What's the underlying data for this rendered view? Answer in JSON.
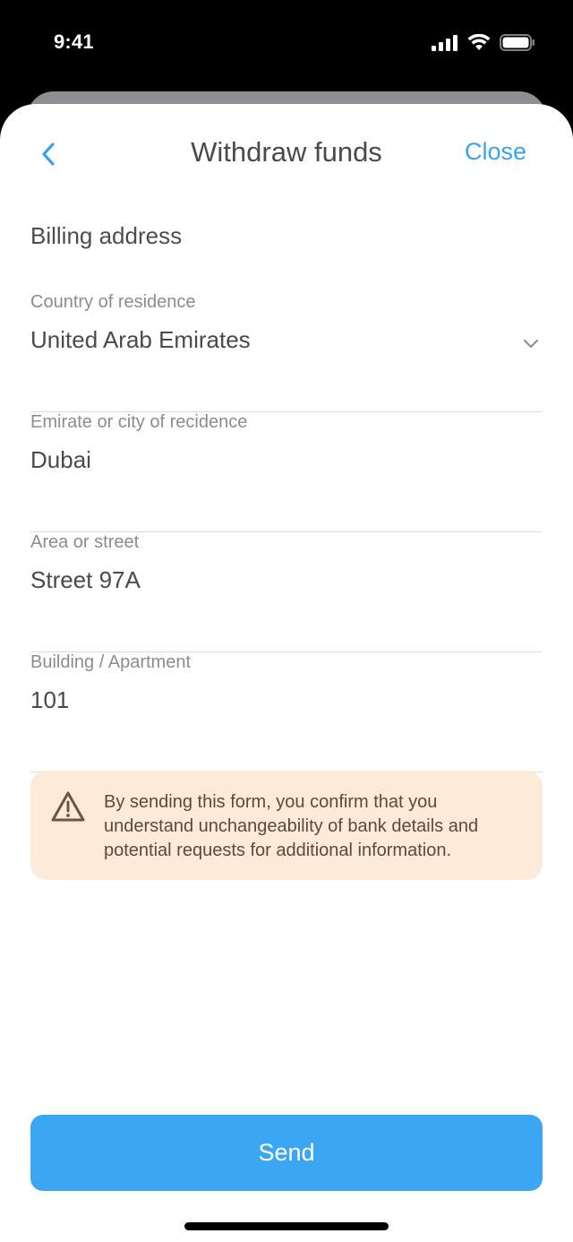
{
  "status_bar": {
    "time": "9:41"
  },
  "nav": {
    "title": "Withdraw funds",
    "close_label": "Close"
  },
  "form": {
    "section_title": "Billing address",
    "fields": [
      {
        "label": "Country of residence",
        "value": "United Arab Emirates",
        "type": "select"
      },
      {
        "label": "Emirate or city of recidence",
        "value": "Dubai",
        "type": "text"
      },
      {
        "label": "Area or street",
        "value": "Street 97A",
        "type": "text"
      },
      {
        "label": "Building / Apartment",
        "value": "101",
        "type": "text"
      }
    ]
  },
  "notice": {
    "icon": "warning-icon",
    "text": "By sending this form, you confirm that you understand unchangeability of bank details and potential requests for additional information."
  },
  "actions": {
    "send_label": "Send"
  },
  "colors": {
    "accent": "#3aa3ec",
    "button": "#3ba6f2",
    "notice_bg": "#fdebda"
  }
}
